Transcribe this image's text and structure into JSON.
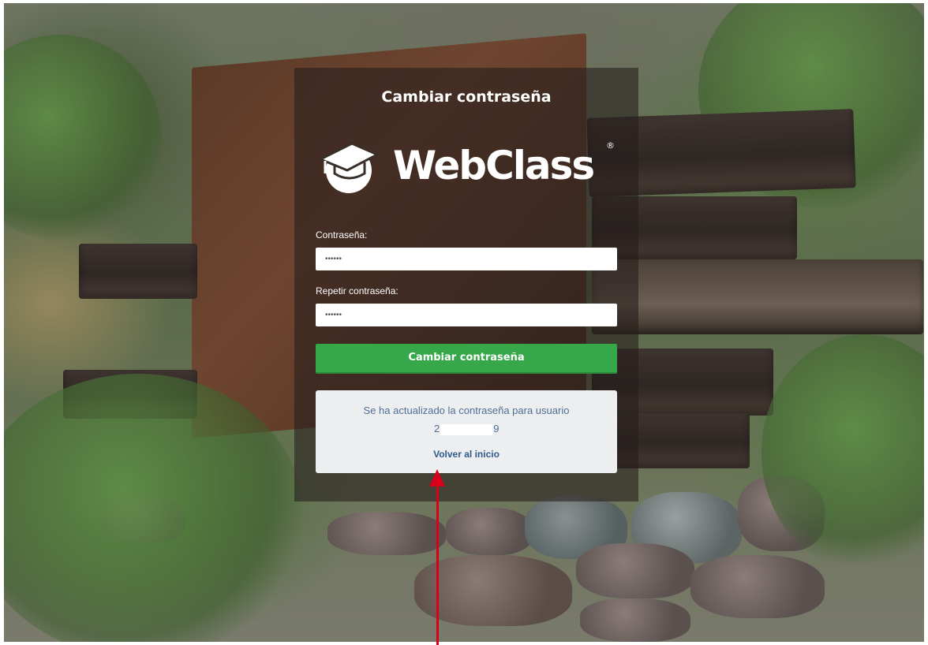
{
  "colors": {
    "panel_overlay": "rgba(38,30,28,0.58)",
    "button_green": "#36a84a",
    "message_bg": "#eceef0",
    "message_text": "#4f6f95",
    "link": "#2e5a8a",
    "annotation_arrow": "#d9001b"
  },
  "panel": {
    "title": "Cambiar contraseña"
  },
  "logo": {
    "icon": "graduation-cap-icon",
    "text": "WebClass",
    "registered": "®"
  },
  "form": {
    "password_label": "Contraseña:",
    "password_value": "••••••",
    "repeat_label": "Repetir contraseña:",
    "repeat_value": "••••••",
    "submit_label": "Cambiar contraseña"
  },
  "message": {
    "text": "Se ha actualizado la contraseña para usuario",
    "user_prefix": "2",
    "user_suffix": "9",
    "link_label": "Volver al inicio"
  },
  "annotation": {
    "icon": "red-arrow-up-icon"
  }
}
